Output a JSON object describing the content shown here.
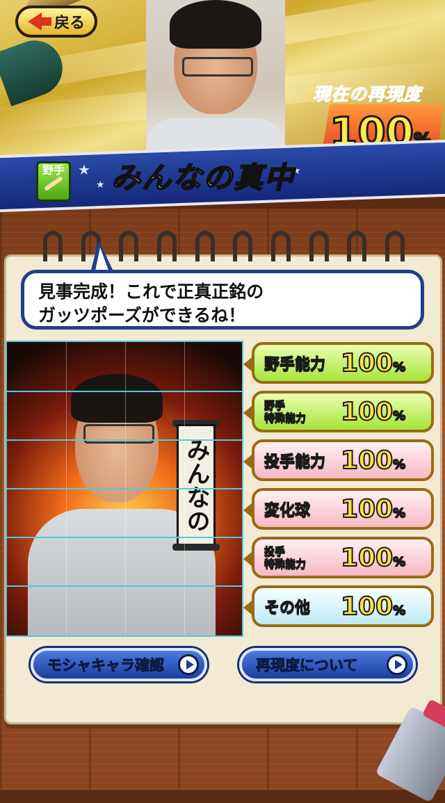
{
  "header": {
    "back_label": "戻る",
    "reproduction_title": "現在の再現度",
    "reproduction_value": "100",
    "reproduction_unit": "%",
    "position_badge": "野手",
    "character_name": "みんなの真中"
  },
  "notebook": {
    "speech_line1": "見事完成！これで正真正銘の",
    "speech_line2": "ガッツポーズができるね！",
    "scroll_text": "みんなの"
  },
  "stats": [
    {
      "label": "野手能力",
      "value": "100",
      "unit": "%",
      "color": "green"
    },
    {
      "label": "野手\n特殊能力",
      "value": "100",
      "unit": "%",
      "color": "green"
    },
    {
      "label": "投手能力",
      "value": "100",
      "unit": "%",
      "color": "pink"
    },
    {
      "label": "変化球",
      "value": "100",
      "unit": "%",
      "color": "pink"
    },
    {
      "label": "投手\n特殊能力",
      "value": "100",
      "unit": "%",
      "color": "pink"
    },
    {
      "label": "その他",
      "value": "100",
      "unit": "%",
      "color": "blue"
    }
  ],
  "buttons": {
    "mosya_check": "モシャキャラ確認",
    "about_reproduction": "再現度について"
  },
  "colors": {
    "stat_green": "#a6e43c",
    "stat_pink": "#f7b8c4",
    "stat_blue": "#bfe9f6",
    "button_blue": "#1a3e9e",
    "value_yellow": "#ffe24a"
  }
}
